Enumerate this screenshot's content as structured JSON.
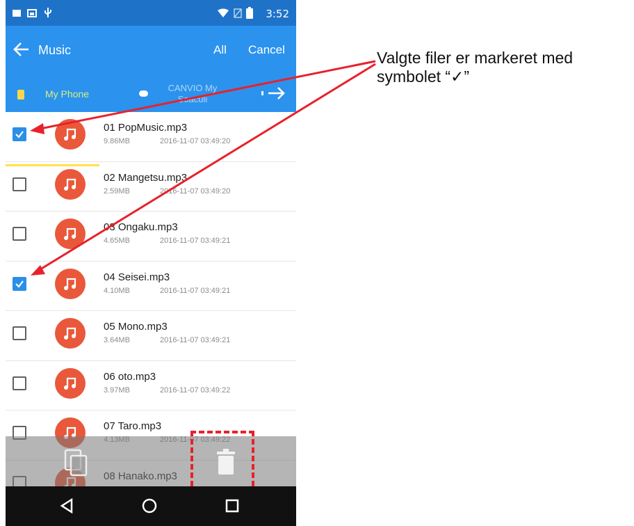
{
  "status_bar": {
    "time": "3:52"
  },
  "app_bar": {
    "title": "Music",
    "all_label": "All",
    "cancel_label": "Cancel"
  },
  "locations": {
    "phone_label": "My Phone",
    "usb_label": "CANVIO My Soaculi"
  },
  "files": [
    {
      "name": "01 PopMusic.mp3",
      "size": "9.86MB",
      "date": "2016-11-07 03:49:20",
      "checked": true
    },
    {
      "name": "02 Mangetsu.mp3",
      "size": "2.59MB",
      "date": "2016-11-07 03:49:20",
      "checked": false
    },
    {
      "name": "03 Ongaku.mp3",
      "size": "4.65MB",
      "date": "2016-11-07 03:49:21",
      "checked": false
    },
    {
      "name": "04 Seisei.mp3",
      "size": "4.10MB",
      "date": "2016-11-07 03:49:21",
      "checked": true
    },
    {
      "name": "05 Mono.mp3",
      "size": "3.64MB",
      "date": "2016-11-07 03:49:21",
      "checked": false
    },
    {
      "name": "06 oto.mp3",
      "size": "3.97MB",
      "date": "2016-11-07 03:49:22",
      "checked": false
    },
    {
      "name": "07 Taro.mp3",
      "size": "4.13MB",
      "date": "2016-11-07 03:49:22",
      "checked": false
    },
    {
      "name": "08 Hanako.mp3",
      "size": "",
      "date": "",
      "checked": false
    }
  ],
  "annotation": {
    "line1": "Valgte filer er markeret med",
    "line2": "symbolet “✓”"
  },
  "colors": {
    "status_bar": "#1e73c9",
    "app_bar": "#2b92ee",
    "music_icon": "#e9583a",
    "checkbox_checked": "#2b8fe6",
    "annotation_red": "#e8212b"
  },
  "icons": {
    "back": "arrow-left-icon",
    "next": "arrow-right-icon",
    "file": "music-note-icon",
    "copy": "copy-icon",
    "delete": "trash-icon"
  }
}
